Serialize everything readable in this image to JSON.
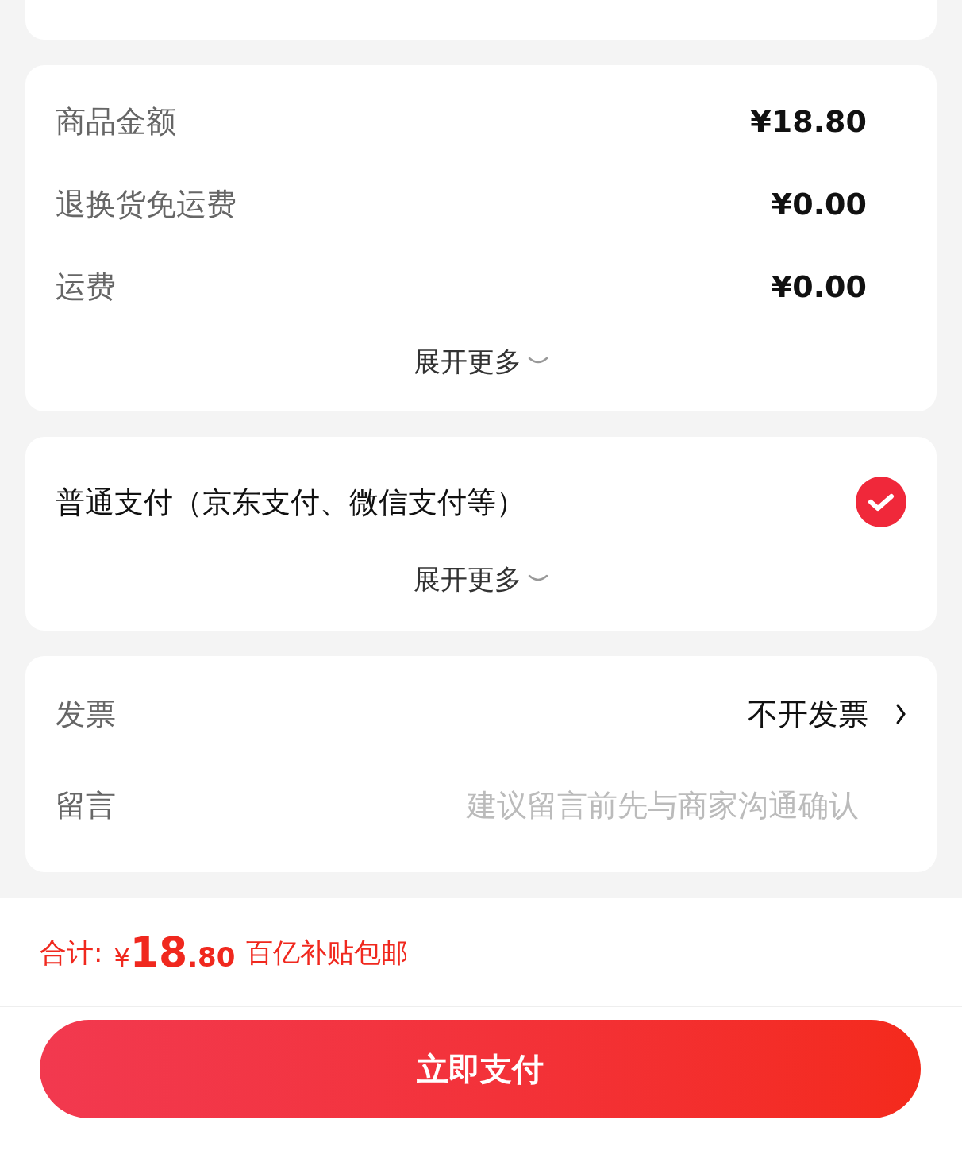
{
  "fees": {
    "rows": [
      {
        "label": "商品金额",
        "value": "¥18.80"
      },
      {
        "label": "退换货免运费",
        "value": "¥0.00"
      },
      {
        "label": "运费",
        "value": "¥0.00"
      }
    ],
    "expand": "展开更多"
  },
  "payment": {
    "options": [
      {
        "label": "普通支付（京东支付、微信支付等）",
        "selected": true
      }
    ],
    "expand": "展开更多"
  },
  "extras": {
    "invoice": {
      "label": "发票",
      "value": "不开发票"
    },
    "message": {
      "label": "留言",
      "placeholder": "建议留言前先与商家沟通确认"
    }
  },
  "total": {
    "label": "合计:",
    "currency": "¥",
    "integer": "18",
    "decimal": ".80",
    "note": "百亿补贴包邮"
  },
  "pay_button": "立即支付"
}
